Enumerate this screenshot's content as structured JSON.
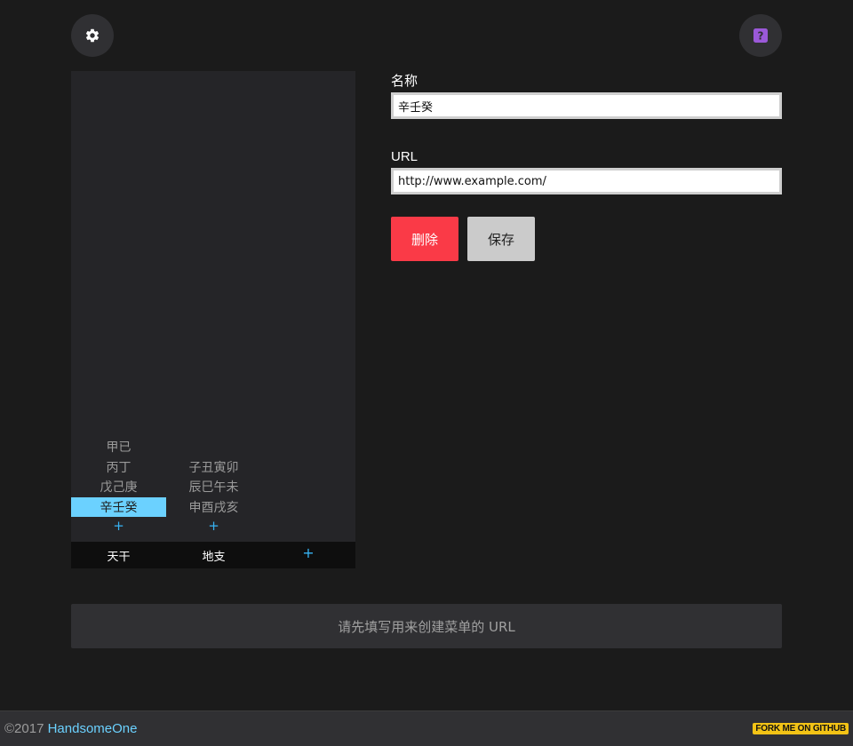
{
  "toolbar": {
    "settings_icon": "gear-icon",
    "help_icon": "help-icon"
  },
  "menu": {
    "columns": [
      {
        "label": "天干",
        "sub_items": [
          "甲已",
          "丙丁",
          "戊己庚",
          "辛壬癸"
        ],
        "active_index": 3,
        "add_label": "+"
      },
      {
        "label": "地支",
        "sub_items": [
          "子丑寅卯",
          "辰巳午未",
          "申酉戌亥"
        ],
        "add_label": "+"
      }
    ],
    "add_column_label": "+"
  },
  "form": {
    "name_label": "名称",
    "name_value": "辛壬癸",
    "url_label": "URL",
    "url_value": "http://www.example.com/",
    "delete_label": "删除",
    "save_label": "保存"
  },
  "hint": {
    "text": "请先填写用来创建菜单的 URL"
  },
  "footer": {
    "copyright_prefix": "©2017 ",
    "author": "HandsomeOne",
    "fork_label": "FORK ME ON GITHUB"
  },
  "colors": {
    "accent": "#6bd1ff",
    "delete": "#fa3a47",
    "help": "#9b59d9",
    "fork_badge": "#f2c316"
  }
}
